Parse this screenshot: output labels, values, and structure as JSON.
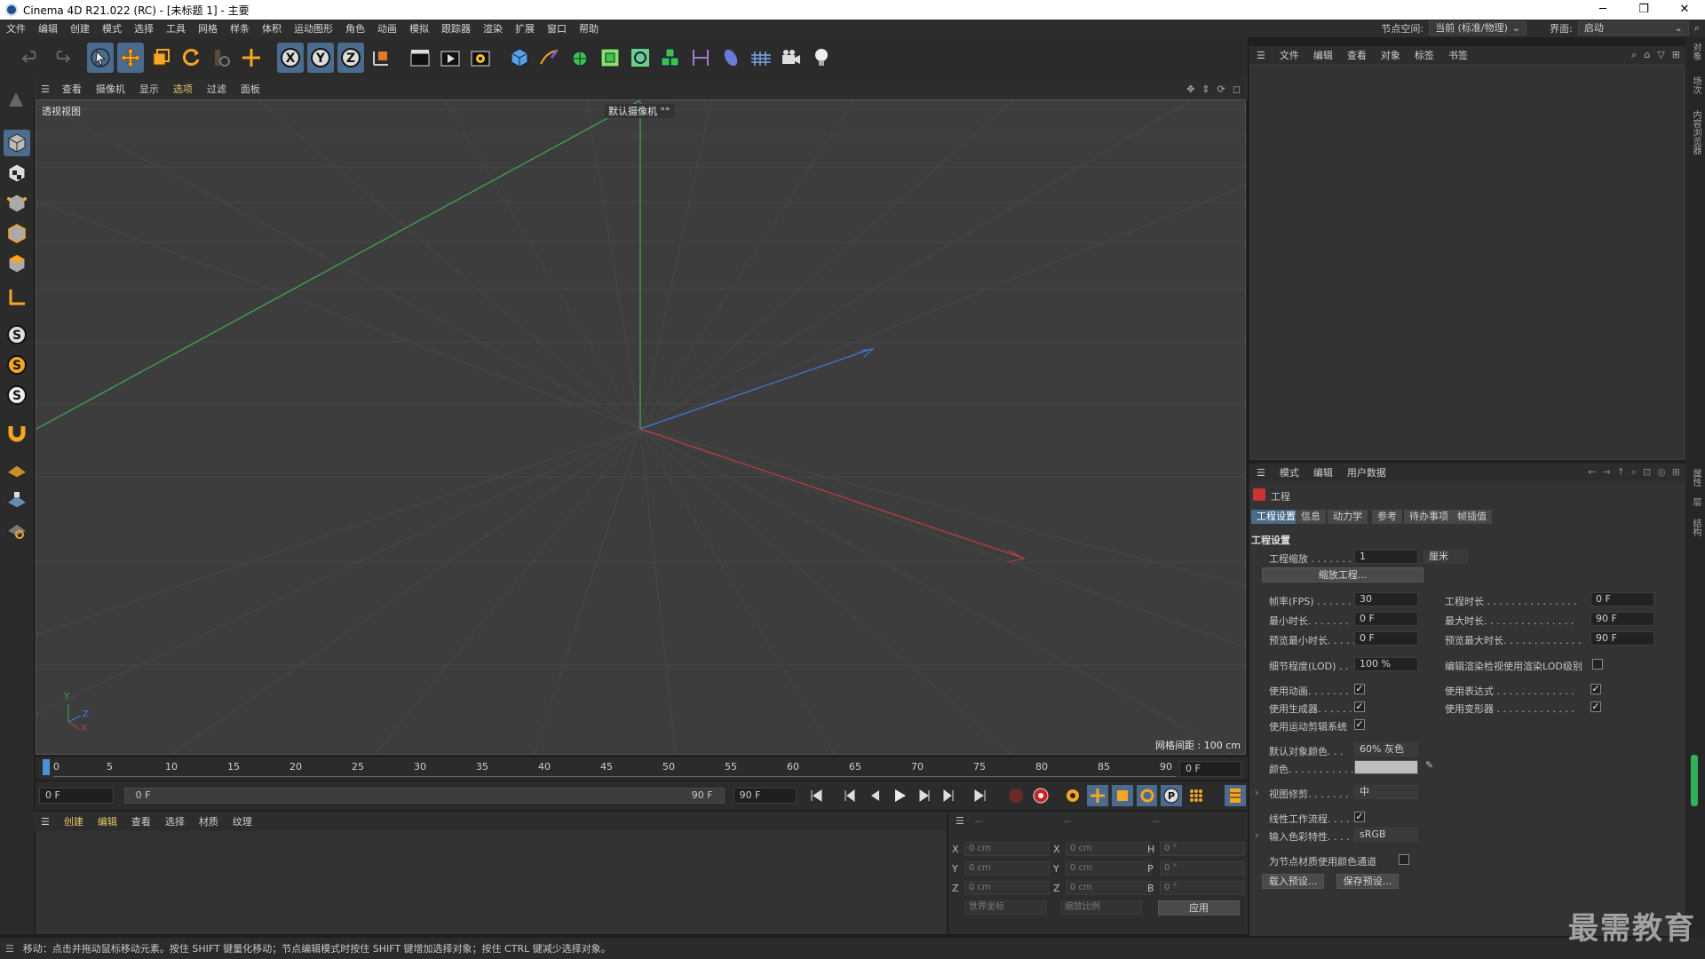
{
  "window": {
    "title": "Cinema 4D R21.022 (RC) - [未标题 1] - 主要",
    "controls": [
      "─",
      "❐",
      "✕"
    ]
  },
  "menubar": {
    "items": [
      "文件",
      "编辑",
      "创建",
      "模式",
      "选择",
      "工具",
      "网格",
      "样条",
      "体积",
      "运动图形",
      "角色",
      "动画",
      "模拟",
      "跟踪器",
      "渲染",
      "扩展",
      "窗口",
      "帮助"
    ],
    "node_space_label": "节点空间:",
    "node_space_value": "当前 (标准/物理)",
    "layout_label": "界面:",
    "layout_value": "启动"
  },
  "viewport": {
    "menu": [
      "查看",
      "摄像机",
      "显示",
      "选项",
      "过滤",
      "面板"
    ],
    "title": "透视视图",
    "camera": "默认摄像机 °°",
    "grid_spacing": "网格间距 : 100 cm",
    "axis_y": "Y",
    "axis_z": "Z",
    "axis_x": "X"
  },
  "timeline": {
    "ruler": [
      "0",
      "5",
      "10",
      "15",
      "20",
      "25",
      "30",
      "35",
      "40",
      "45",
      "50",
      "55",
      "60",
      "65",
      "70",
      "75",
      "80",
      "85",
      "90"
    ],
    "current_frame_field": "0 F",
    "start_field": "0 F",
    "range_start": "0 F",
    "range_end": "90 F",
    "end_field": "90 F"
  },
  "material": {
    "menu": [
      "创建",
      "编辑",
      "查看",
      "选择",
      "材质",
      "纹理"
    ]
  },
  "coordinates": {
    "headers": [
      "--",
      "--",
      "--"
    ],
    "rows": [
      {
        "a": "X",
        "av": "0 cm",
        "b": "X",
        "bv": "0 cm",
        "c": "H",
        "cv": "0 °"
      },
      {
        "a": "Y",
        "av": "0 cm",
        "b": "Y",
        "bv": "0 cm",
        "c": "P",
        "cv": "0 °"
      },
      {
        "a": "Z",
        "av": "0 cm",
        "b": "Z",
        "bv": "0 cm",
        "c": "B",
        "cv": "0 °"
      }
    ],
    "world": "世界坐标",
    "scale": "缩放比例",
    "apply": "应用"
  },
  "status": "移动：点击并拖动鼠标移动元素。按住 SHIFT 键量化移动；节点编辑模式时按住 SHIFT 键增加选择对象；按住 CTRL 键减少选择对象。",
  "objects": {
    "menu": [
      "文件",
      "编辑",
      "查看",
      "对象",
      "标签",
      "书签"
    ]
  },
  "attributes": {
    "menu": [
      "模式",
      "编辑",
      "用户数据"
    ],
    "object_name": "工程",
    "tabs": [
      "工程设置",
      "信息",
      "动力学",
      "参考",
      "待办事项",
      "帧插值"
    ],
    "section": "工程设置",
    "scale_label": "工程缩放 . . . . . . .",
    "scale_value": "1",
    "scale_unit": "厘米",
    "scale_button": "缩放工程...",
    "fps_label": "帧率(FPS) . . . . . .",
    "fps_value": "30",
    "proj_len_label": "工程时长 . . . . . . . . . . . . . . .",
    "proj_len_value": "0 F",
    "min_len_label": "最小时长. . . . . . .",
    "min_len_value": "0 F",
    "max_len_label": "最大时长. . . . . . . . . . . . . . .",
    "max_len_value": "90 F",
    "prev_min_label": "预览最小时长. . . . .",
    "prev_min_value": "0 F",
    "prev_max_label": "预览最大时长. . . . . . . . . . . . .",
    "prev_max_value": "90 F",
    "lod_label": "细节程度(LOD) . .",
    "lod_value": "100 %",
    "render_lod_label": "编辑渲染检视使用渲染LOD级别",
    "use_anim_label": "使用动画. . . . . . .",
    "use_expr_label": "使用表达式 . . . . . . . . . . . . .",
    "use_gen_label": "使用生成器. . . . . .",
    "use_deform_label": "使用变形器 . . . . . . . . . . . . .",
    "use_mograph_label": "使用运动剪辑系统",
    "default_color_label": "默认对象颜色. . .",
    "default_color_value": "60% 灰色",
    "color_label": "颜色. . . . . . . . . . .",
    "view_clip_label": "视图修剪. . . . . . .",
    "view_clip_value": "中",
    "linear_label": "线性工作流程. . . .",
    "input_color_label": "输入色彩特性. . . .",
    "input_color_value": "sRGB",
    "node_color_label": "为节点材质使用颜色通道",
    "load_preset": "载入预设...",
    "save_preset": "保存预设..."
  },
  "side_tabs": {
    "top": [
      "对象",
      "场次",
      "内容浏览器"
    ],
    "bottom": [
      "属性",
      "层",
      "结构"
    ]
  },
  "watermark": "最需教育"
}
